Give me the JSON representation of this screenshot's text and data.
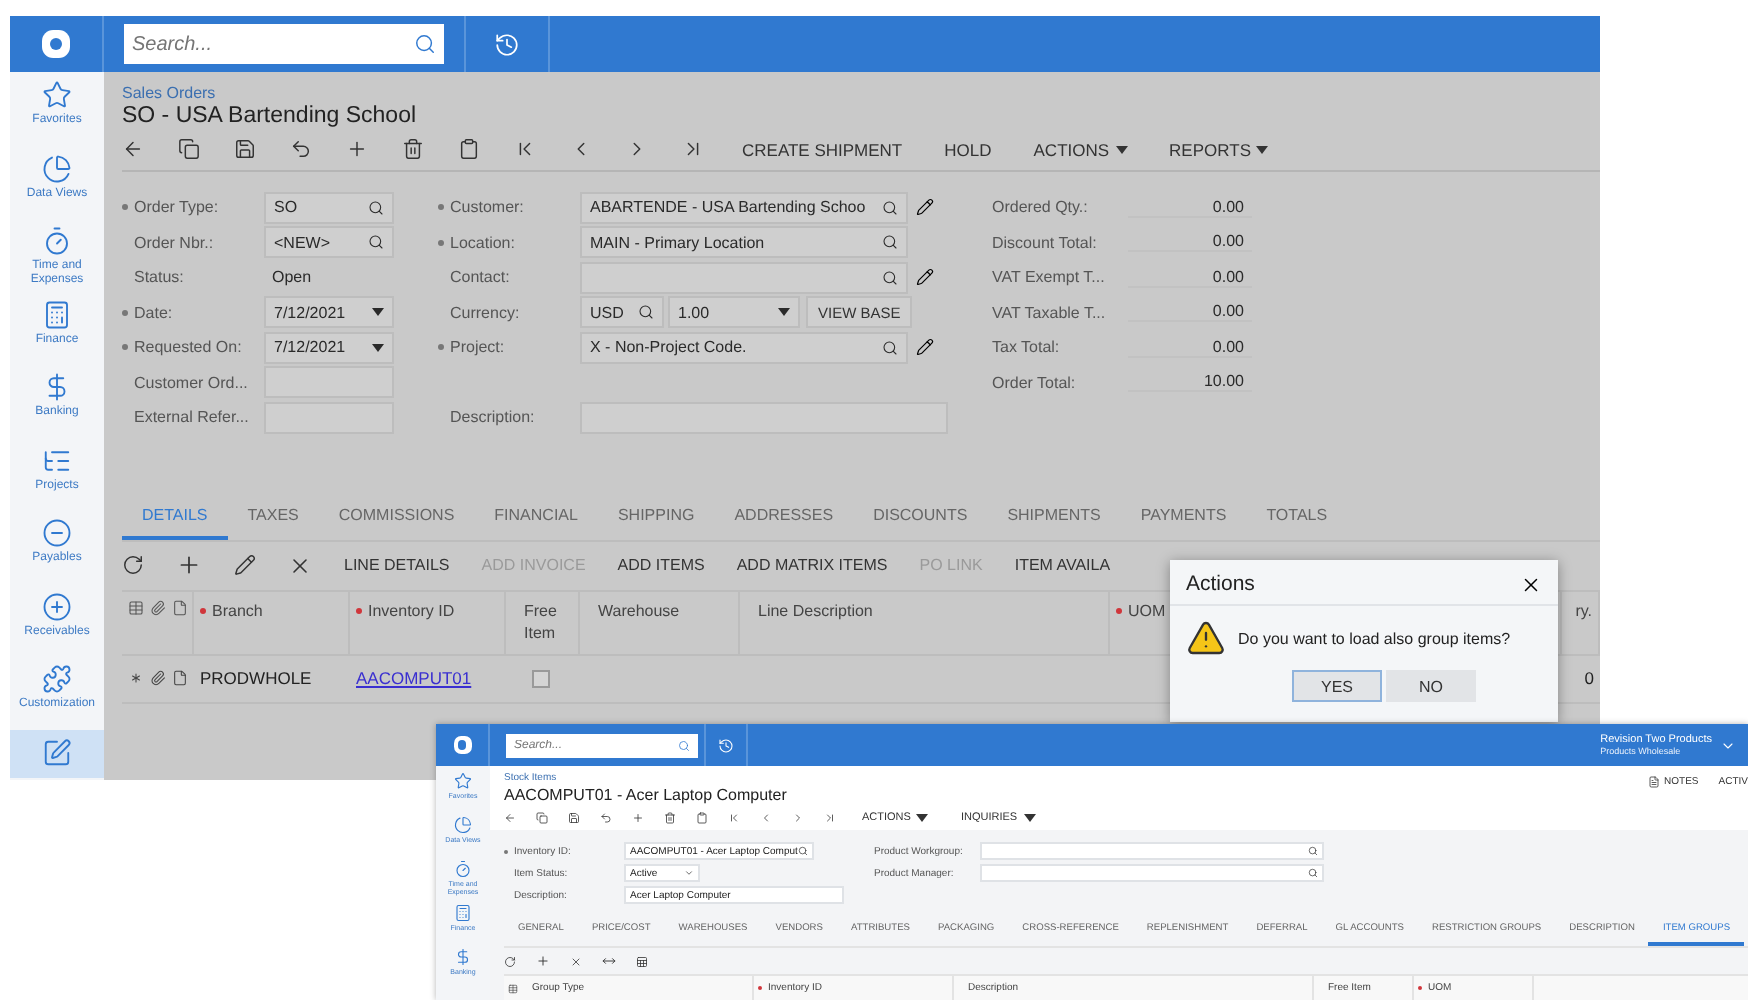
{
  "main": {
    "search": {
      "placeholder": "Search..."
    },
    "sidebar": [
      {
        "label": "Favorites",
        "selected": false
      },
      {
        "label": "Data Views",
        "selected": false
      },
      {
        "label": "Time and Expenses",
        "selected": false
      },
      {
        "label": "Finance",
        "selected": false
      },
      {
        "label": "Banking",
        "selected": false
      },
      {
        "label": "Projects",
        "selected": false
      },
      {
        "label": "Payables",
        "selected": false
      },
      {
        "label": "Receivables",
        "selected": false
      },
      {
        "label": "Customization",
        "selected": false
      },
      {
        "selected": true
      }
    ],
    "breadcrumb": "Sales Orders",
    "title": "SO - USA Bartending School",
    "toolbar_buttons": [
      {
        "label": "CREATE SHIPMENT",
        "kind": "button"
      },
      {
        "label": "HOLD",
        "kind": "button"
      },
      {
        "label": "ACTIONS",
        "kind": "menu"
      },
      {
        "label": "REPORTS",
        "kind": "menu"
      }
    ],
    "form_left": [
      {
        "label": "Order Type:",
        "required": true,
        "kind": "lookup",
        "value": "SO"
      },
      {
        "label": "Order Nbr.:",
        "required": false,
        "kind": "lookup",
        "value": "<NEW>"
      },
      {
        "label": "Status:",
        "required": false,
        "kind": "text",
        "value": "Open"
      },
      {
        "label": "Date:",
        "required": true,
        "kind": "select",
        "value": "7/12/2021"
      },
      {
        "label": "Requested On:",
        "required": true,
        "kind": "select",
        "value": "7/12/2021"
      },
      {
        "label": "Customer Ord...",
        "required": false,
        "kind": "input"
      },
      {
        "label": "External Refer...",
        "required": false,
        "kind": "input"
      }
    ],
    "form_middle": [
      {
        "label": "Customer:",
        "required": true,
        "kind": "lookup",
        "value": "ABARTENDE - USA Bartending Schoo",
        "editable": true
      },
      {
        "label": "Location:",
        "required": true,
        "kind": "lookup",
        "value": "MAIN - Primary Location",
        "editable": false
      },
      {
        "label": "Contact:",
        "required": false,
        "kind": "lookup",
        "editable": true
      },
      {
        "label": "Currency:",
        "required": false,
        "kind": "currency",
        "value": "USD",
        "rate": "1.00",
        "button": "VIEW BASE"
      },
      {
        "label": "Project:",
        "required": true,
        "kind": "lookup",
        "value": "X - Non-Project Code.",
        "editable": true
      },
      {
        "kind": "spacer"
      },
      {
        "label": "Description:",
        "required": false,
        "kind": "wide"
      }
    ],
    "totals": [
      {
        "label": "Ordered Qty.:",
        "value": "0.00"
      },
      {
        "label": "Discount Total:",
        "value": "0.00"
      },
      {
        "label": "VAT Exempt T...",
        "value": "0.00"
      },
      {
        "label": "VAT Taxable T...",
        "value": "0.00"
      },
      {
        "label": "Tax Total:",
        "value": "0.00"
      },
      {
        "label": "Order Total:",
        "value": "10.00"
      }
    ],
    "tabs": [
      {
        "label": "DETAILS",
        "selected": true
      },
      {
        "label": "TAXES",
        "selected": false
      },
      {
        "label": "COMMISSIONS",
        "selected": false
      },
      {
        "label": "FINANCIAL",
        "selected": false
      },
      {
        "label": "SHIPPING",
        "selected": false
      },
      {
        "label": "ADDRESSES",
        "selected": false
      },
      {
        "label": "DISCOUNTS",
        "selected": false
      },
      {
        "label": "SHIPMENTS",
        "selected": false
      },
      {
        "label": "PAYMENTS",
        "selected": false
      },
      {
        "label": "TOTALS",
        "selected": false
      }
    ],
    "grid_actions": [
      {
        "label": "LINE DETAILS",
        "disabled": false
      },
      {
        "label": "ADD INVOICE",
        "disabled": true
      },
      {
        "label": "ADD ITEMS",
        "disabled": false
      },
      {
        "label": "ADD MATRIX ITEMS",
        "disabled": false
      },
      {
        "label": "PO LINK",
        "disabled": true
      },
      {
        "label": "ITEM AVAILA",
        "disabled": false
      }
    ],
    "columns": [
      {
        "label": "Branch",
        "required": true
      },
      {
        "label": "Inventory ID",
        "required": true
      },
      {
        "label": "Free Item",
        "required": false
      },
      {
        "label": "Warehouse",
        "required": false
      },
      {
        "label": "Line Description",
        "required": false
      },
      {
        "label": "UOM",
        "required": true
      },
      {
        "label": "ry.",
        "required": false
      }
    ],
    "row": {
      "branch": "PRODWHOLE",
      "inventory_id": "AACOMPUT01",
      "free_item": false,
      "column_7": "0"
    }
  },
  "dialog": {
    "title": "Actions",
    "message": "Do you want to load also group items?",
    "buttons": [
      {
        "label": "YES",
        "selected": true
      },
      {
        "label": "NO",
        "selected": false
      }
    ]
  },
  "stock_window": {
    "search": {
      "placeholder": "Search..."
    },
    "company": "Revision Two Products",
    "branch": "Products Wholesale",
    "sidebar": [
      {
        "label": "Favorites"
      },
      {
        "label": "Data Views"
      },
      {
        "label": "Time and Expenses"
      },
      {
        "label": "Finance"
      },
      {
        "label": "Banking"
      }
    ],
    "breadcrumb": "Stock Items",
    "title": "AACOMPUT01 - Acer Laptop Computer",
    "toolbar_menus": [
      "ACTIONS",
      "INQUIRIES"
    ],
    "notes": "NOTES",
    "activities": "ACTIV",
    "form_left": [
      {
        "label": "Inventory ID:",
        "required": true,
        "kind": "lookup",
        "value": "AACOMPUT01 - Acer Laptop Comput"
      },
      {
        "label": "Item Status:",
        "required": false,
        "kind": "select",
        "value": "Active"
      },
      {
        "label": "Description:",
        "required": false,
        "kind": "wide",
        "value": "Acer Laptop Computer"
      }
    ],
    "form_right": [
      {
        "label": "Product Workgroup:",
        "kind": "lookup"
      },
      {
        "label": "Product Manager:",
        "kind": "lookup"
      }
    ],
    "tabs": [
      {
        "label": "GENERAL",
        "selected": false
      },
      {
        "label": "PRICE/COST",
        "selected": false
      },
      {
        "label": "WAREHOUSES",
        "selected": false
      },
      {
        "label": "VENDORS",
        "selected": false
      },
      {
        "label": "ATTRIBUTES",
        "selected": false
      },
      {
        "label": "PACKAGING",
        "selected": false
      },
      {
        "label": "CROSS-REFERENCE",
        "selected": false
      },
      {
        "label": "REPLENISHMENT",
        "selected": false
      },
      {
        "label": "DEFERRAL",
        "selected": false
      },
      {
        "label": "GL ACCOUNTS",
        "selected": false
      },
      {
        "label": "RESTRICTION GROUPS",
        "selected": false
      },
      {
        "label": "DESCRIPTION",
        "selected": false
      },
      {
        "label": "ITEM GROUPS",
        "selected": true
      }
    ],
    "columns": [
      {
        "label": "Group Type",
        "required": false
      },
      {
        "label": "Inventory ID",
        "required": true
      },
      {
        "label": "Description",
        "required": false
      },
      {
        "label": "Free Item",
        "required": false
      },
      {
        "label": "UOM",
        "required": true
      }
    ]
  }
}
